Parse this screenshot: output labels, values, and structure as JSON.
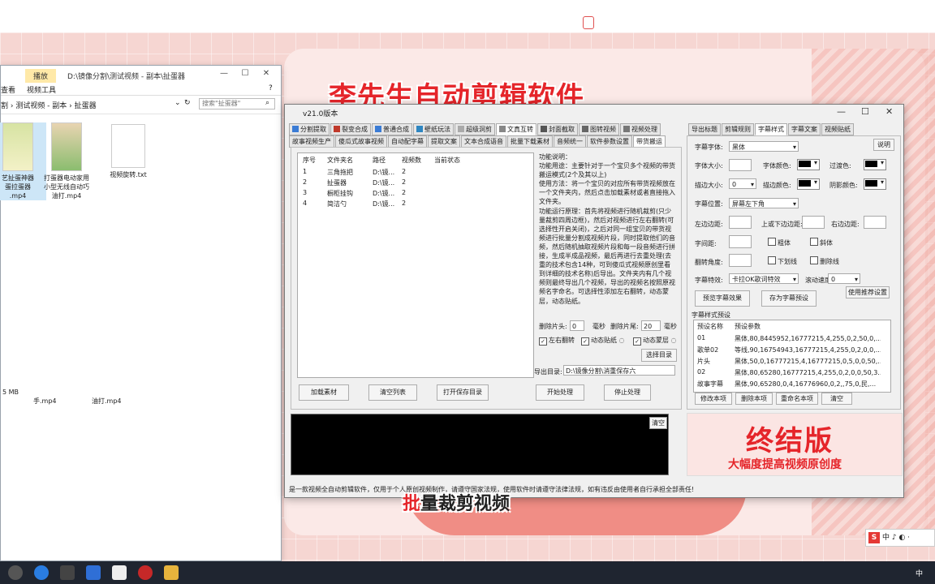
{
  "background": {
    "headline": "李先生自动剪辑软件",
    "caption_hl": "批",
    "caption_rest": "量裁剪视频"
  },
  "explorer": {
    "play_tab": "播放",
    "path": "D:\\镜像分割\\测试视频 - 副本\\扯蛋器",
    "ribbon_left": "查看",
    "ribbon_tool": "视频工具",
    "crumbs": "割  ›  测试视频 - 副本  ›  扯蛋器",
    "search_placeholder": "搜索\"扯蛋器\"",
    "files": [
      {
        "name": "艺扯蛋神器\n蛋拉蛋器\n.mp4"
      },
      {
        "name": "打蛋器电动家用\n小型无线自动巧\n油打.mp4"
      },
      {
        "name": "视频旋转.txt"
      }
    ],
    "status": "5 MB",
    "lower_files": [
      "手.mp4",
      "油打.mp4"
    ]
  },
  "app": {
    "version": "v21.0版本",
    "tabs_row1": [
      "分割提取",
      "裂变合成",
      "普通合成",
      "壁纸玩法",
      "超级洞剪",
      "文真互转",
      "封面截取",
      "图转视频",
      "视频处理"
    ],
    "tabs_row2": [
      "故事视频生产",
      "傻瓜式故事视频",
      "自动配字幕",
      "提取文案",
      "文本合成语音",
      "批量下载素材",
      "音频统一",
      "软件参数设置",
      "带货搬运"
    ],
    "columns": [
      "序号",
      "文件夹名",
      "路径",
      "视频数",
      "当前状态"
    ],
    "rows": [
      {
        "no": "1",
        "name": "三角拖把",
        "path": "D:\\镜...",
        "count": "2",
        "state": ""
      },
      {
        "no": "2",
        "name": "扯蛋器",
        "path": "D:\\镜...",
        "count": "2",
        "state": ""
      },
      {
        "no": "3",
        "name": "橱柜挂钩",
        "path": "D:\\镜...",
        "count": "2",
        "state": ""
      },
      {
        "no": "4",
        "name": "简洁勺",
        "path": "D:\\镜...",
        "count": "2",
        "state": ""
      }
    ],
    "desc": "功能说明：\n功能用途：主要针对于一个宝贝多个视频的带货搬运模式(2个及其以上)\n使用方法：将一个宝贝的对应所有带货视频放在一个文件夹内，然后点击加载素材或者直接拖入文件夹。\n功能运行原理：首先将视频进行随机裁剪(只少量裁剪四周边框)，然后对视频进行左右翻转(可选择性开启关闭)，之后对同一组宝贝的带货视频进行批量分割成视频片段，同时提取他们的音频，然后随机抽取视频片段和每一段音频进行拼接，生成半成品视频，最后再进行去重处理(去重的技术包含14种，可到傻瓜式视频原创里看到详细的技术名称)后导出。文件夹内有几个视频则最终导出几个视频，导出的视频名按照原视频名字命名。可选择性添加左右翻转，动态蒙层，动态贴纸。",
    "cut_head_label": "删除片头:",
    "cut_head_val": "0",
    "cut_unit1": "毫秒",
    "cut_tail_label": "删除片尾:",
    "cut_tail_val": "20",
    "cut_unit2": "毫秒",
    "chk_flip": "左右翻转",
    "chk_sticker": "动态贴纸",
    "chk_mask": "动态蒙层",
    "choose_dir": "选择目录",
    "out_label": "导出目录:",
    "out_path": "D:\\镜像分割\\消重保存六",
    "btn_load": "加载素材",
    "btn_clear_list": "清空列表",
    "btn_open_dir": "打开保存目录",
    "btn_start": "开始处理",
    "btn_stop": "停止处理",
    "console_clear": "清空",
    "footer": "是一款视频全自动剪辑软件，仅用于个人原创视频制作，请遵守国家法规，使用软件时请遵守法律法规，如有违反由使用者自行承担全部责任!"
  },
  "subtitle": {
    "tabs": [
      "导出标题",
      "剪辑规则",
      "字幕样式",
      "字幕文案",
      "视频贴纸"
    ],
    "font_label": "字幕字体:",
    "font_val": "黑体",
    "explain": "说明",
    "size_label": "字体大小:",
    "color_label": "字体颜色:",
    "over_label": "过渡色:",
    "stroke_label": "描边大小:",
    "stroke_val": "0",
    "stroke_color_label": "描边颜色:",
    "shadow_label": "阴影颜色:",
    "pos_label": "字幕位置:",
    "pos_val": "屏幕左下角",
    "left_label": "左边边距:",
    "tb_label": "上或下边边距:",
    "right_label": "右边边距:",
    "spacing_label": "字间距:",
    "bold": "粗体",
    "italic": "斜体",
    "angle_label": "翻转角度:",
    "underline": "下划线",
    "strike": "删除线",
    "effect_label": "字幕特效:",
    "effect_val": "卡拉OK歌词特效",
    "speed_label": "滚动速度:",
    "speed_val": "0",
    "use_preset": "使用推荐设置",
    "preview": "预览字幕效果",
    "save_preset": "存为字幕预设",
    "preset_title": "字幕样式预设",
    "preset_cols": [
      "预设名称",
      "预设参数"
    ],
    "presets": [
      {
        "name": "01",
        "params": "黑体,80,8445952,16777215,4,255,0,2,50,0,..."
      },
      {
        "name": "歌单02",
        "params": "等线,90,16754943,16777215,4,255,0,2,0,0,..."
      },
      {
        "name": "片头",
        "params": "黑体,50,0,16777215,4,16777215,0,5,0,0,50,..."
      },
      {
        "name": "02",
        "params": "黑体,80,65280,16777215,4,255,0,2,0,0,50,3..."
      },
      {
        "name": "故事字幕",
        "params": "黑体,90,65280,0,4,16776960,0,2,,75,0,民,..."
      }
    ],
    "btn_edit": "修改本项",
    "btn_delete": "删除本项",
    "btn_rename": "重命名本项",
    "btn_clear": "清空"
  },
  "promo": {
    "title": "终结版",
    "sub": "大幅度提高视频原创度"
  },
  "ime": {
    "text": "中 ♪ ◐ ·"
  },
  "tray": {
    "time": "中"
  }
}
